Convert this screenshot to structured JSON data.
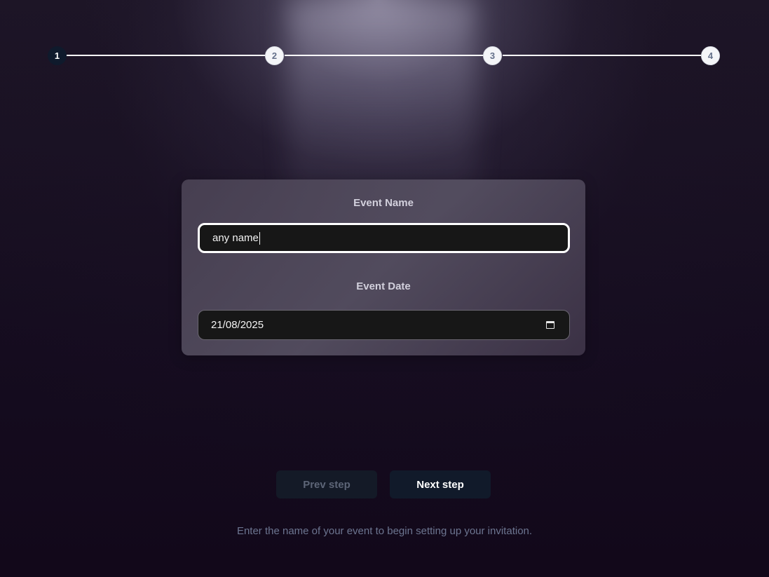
{
  "stepper": {
    "steps": [
      "1",
      "2",
      "3",
      "4"
    ],
    "current": 1
  },
  "form": {
    "event_name_label": "Event Name",
    "event_name_value": "any name",
    "event_date_label": "Event Date",
    "event_date_value": "21/08/2025"
  },
  "buttons": {
    "prev_label": "Prev step",
    "next_label": "Next step"
  },
  "hint_text": "Enter the name of your event to begin setting up your invitation.",
  "colors": {
    "background": "#14091c",
    "active_step": "#0f1a2c",
    "button": "#111a2a"
  },
  "icons": {
    "date_picker": "calendar-icon"
  }
}
